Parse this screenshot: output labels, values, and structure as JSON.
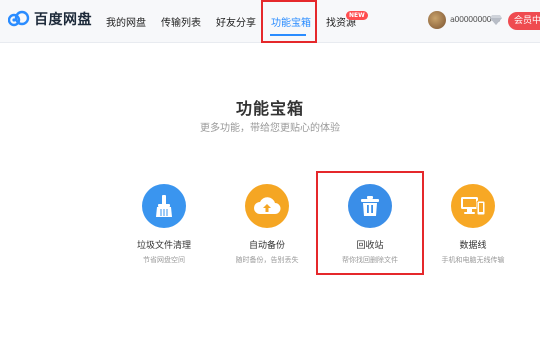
{
  "header": {
    "logo_text": "百度网盘",
    "nav": [
      {
        "label": "我的网盘"
      },
      {
        "label": "传输列表"
      },
      {
        "label": "好友分享"
      },
      {
        "label": "功能宝箱"
      },
      {
        "label": "找资源"
      }
    ],
    "new_badge": "NEW",
    "username": "a0000000049",
    "vip_label": "会员中心",
    "colors": {
      "accent": "#2a8cff",
      "highlight_box": "#e5282b",
      "vip": "#ef4b50"
    }
  },
  "main": {
    "title": "功能宝箱",
    "subtitle": "更多功能，带给您更贴心的体验",
    "tools": [
      {
        "name": "垃圾文件清理",
        "desc": "节省网盘空间",
        "icon": "broom-icon",
        "color": "#3a95ef"
      },
      {
        "name": "自动备份",
        "desc": "随时备份，告别丢失",
        "icon": "cloud-upload-icon",
        "color": "#f5a623"
      },
      {
        "name": "回收站",
        "desc": "帮你找回删除文件",
        "icon": "trash-icon",
        "color": "#3a8ee8"
      },
      {
        "name": "数据线",
        "desc": "手机和电脑无线传输",
        "icon": "devices-icon",
        "color": "#f7a825"
      }
    ]
  }
}
